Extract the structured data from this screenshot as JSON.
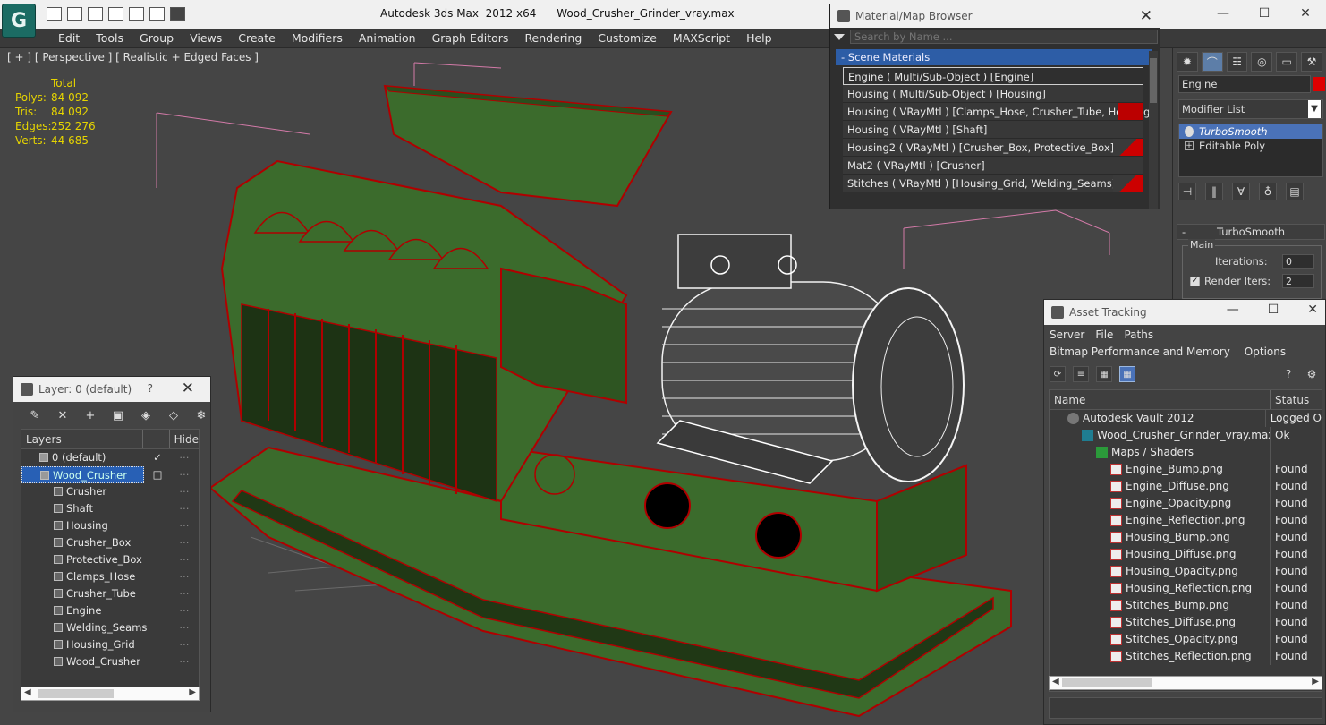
{
  "app": {
    "logo": "G",
    "title": "Autodesk 3ds Max  2012 x64      Wood_Crusher_Grinder_vray.max",
    "controls": [
      "—",
      "☐",
      "✕"
    ]
  },
  "menu": [
    "Edit",
    "Tools",
    "Group",
    "Views",
    "Create",
    "Modifiers",
    "Animation",
    "Graph Editors",
    "Rendering",
    "Customize",
    "MAXScript",
    "Help"
  ],
  "viewport": {
    "label": "[ + ] [ Perspective ] [ Realistic + Edged Faces ]",
    "stats_header": "Total",
    "stats": [
      {
        "k": "Polys:",
        "v": "84 092"
      },
      {
        "k": "Tris:",
        "v": "84 092"
      },
      {
        "k": "Edges:",
        "v": "252 276"
      },
      {
        "k": "Verts:",
        "v": "44 685"
      }
    ],
    "colors": {
      "stats": "#e6d400",
      "model_green": "#3f6a2e",
      "edge_red": "#b30000"
    }
  },
  "material_browser": {
    "title": "Material/Map Browser",
    "search_placeholder": "Search by Name ...",
    "group": "- Scene Materials",
    "materials": [
      {
        "label": "Engine  ( Multi/Sub-Object )  [Engine]",
        "swatch": "none",
        "selected": true
      },
      {
        "label": "Housing  ( Multi/Sub-Object )  [Housing]",
        "swatch": "none"
      },
      {
        "label": "Housing  ( VRayMtl )  [Clamps_Hose, Crusher_Tube, Housing]",
        "swatch": "full"
      },
      {
        "label": "Housing  ( VRayMtl )  [Shaft]",
        "swatch": "none"
      },
      {
        "label": "Housing2  ( VRayMtl )  [Crusher_Box, Protective_Box]",
        "swatch": "half"
      },
      {
        "label": "Mat2  ( VRayMtl )  [Crusher]",
        "swatch": "none"
      },
      {
        "label": "Stitches  ( VRayMtl )  [Housing_Grid, Welding_Seams]",
        "swatch": "half"
      }
    ]
  },
  "command_panel": {
    "object_name": "Engine",
    "modifier_list": "Modifier List",
    "stack": [
      {
        "label": "TurboSmooth",
        "selected": true
      },
      {
        "label": "Editable Poly",
        "selected": false
      }
    ],
    "rollout": "TurboSmooth",
    "group": "Main",
    "iterations_label": "Iterations:",
    "iterations_value": "0",
    "render_iters_label": "Render Iters:",
    "render_iters_value": "2",
    "render_iters_checked": true
  },
  "asset_tracking": {
    "title": "Asset Tracking",
    "menu1": [
      "Server",
      "File",
      "Paths"
    ],
    "menu2": [
      "Bitmap Performance and Memory",
      "Options"
    ],
    "columns": [
      "Name",
      "Status"
    ],
    "rows": [
      {
        "name": "Autodesk Vault 2012",
        "status": "Logged O",
        "indent": 1,
        "icon": "vault"
      },
      {
        "name": "Wood_Crusher_Grinder_vray.max",
        "status": "Ok",
        "indent": 2,
        "icon": "max"
      },
      {
        "name": "Maps / Shaders",
        "status": "",
        "indent": 3,
        "icon": "maps"
      },
      {
        "name": "Engine_Bump.png",
        "status": "Found",
        "indent": 4,
        "icon": "png"
      },
      {
        "name": "Engine_Diffuse.png",
        "status": "Found",
        "indent": 4,
        "icon": "png"
      },
      {
        "name": "Engine_Opacity.png",
        "status": "Found",
        "indent": 4,
        "icon": "png"
      },
      {
        "name": "Engine_Reflection.png",
        "status": "Found",
        "indent": 4,
        "icon": "png"
      },
      {
        "name": "Housing_Bump.png",
        "status": "Found",
        "indent": 4,
        "icon": "png"
      },
      {
        "name": "Housing_Diffuse.png",
        "status": "Found",
        "indent": 4,
        "icon": "png"
      },
      {
        "name": "Housing_Opacity.png",
        "status": "Found",
        "indent": 4,
        "icon": "png"
      },
      {
        "name": "Housing_Reflection.png",
        "status": "Found",
        "indent": 4,
        "icon": "png"
      },
      {
        "name": "Stitches_Bump.png",
        "status": "Found",
        "indent": 4,
        "icon": "png"
      },
      {
        "name": "Stitches_Diffuse.png",
        "status": "Found",
        "indent": 4,
        "icon": "png"
      },
      {
        "name": "Stitches_Opacity.png",
        "status": "Found",
        "indent": 4,
        "icon": "png"
      },
      {
        "name": "Stitches_Reflection.png",
        "status": "Found",
        "indent": 4,
        "icon": "png"
      }
    ]
  },
  "layers": {
    "title": "Layer: 0 (default)",
    "help": "?",
    "columns": [
      "Layers",
      "Hide"
    ],
    "rows": [
      {
        "name": "0 (default)",
        "level": 1,
        "check": "✓"
      },
      {
        "name": "Wood_Crusher",
        "level": 1,
        "selected": true,
        "toggle": "−",
        "check": "□"
      },
      {
        "name": "Crusher",
        "level": 2
      },
      {
        "name": "Shaft",
        "level": 2
      },
      {
        "name": "Housing",
        "level": 2
      },
      {
        "name": "Crusher_Box",
        "level": 2
      },
      {
        "name": "Protective_Box",
        "level": 2
      },
      {
        "name": "Clamps_Hose",
        "level": 2
      },
      {
        "name": "Crusher_Tube",
        "level": 2
      },
      {
        "name": "Engine",
        "level": 2
      },
      {
        "name": "Welding_Seams",
        "level": 2
      },
      {
        "name": "Housing_Grid",
        "level": 2
      },
      {
        "name": "Wood_Crusher",
        "level": 2
      }
    ]
  }
}
